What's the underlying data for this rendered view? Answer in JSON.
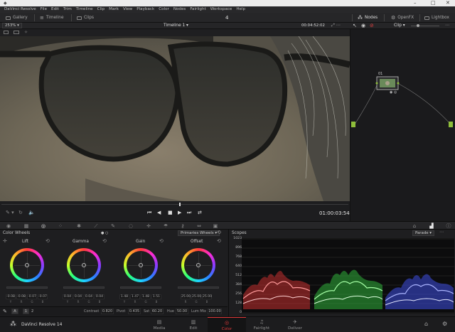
{
  "window": {
    "title": "DaVinci Resolve 14"
  },
  "menu": [
    "DaVinci Resolve",
    "File",
    "Edit",
    "Trim",
    "Timeline",
    "Clip",
    "Mark",
    "View",
    "Playback",
    "Color",
    "Nodes",
    "Fairlight",
    "Workspace",
    "Help"
  ],
  "topbar": {
    "gallery": "Gallery",
    "timeline": "Timeline",
    "clips": "Clips",
    "center_num": "4",
    "nodes": "Nodes",
    "openfx": "OpenFX",
    "lightbox": "Lightbox"
  },
  "viewer": {
    "zoom": "253%",
    "timeline_name": "Timeline 1",
    "timecode_top": "00:04:52:02",
    "timecode_bottom": "01:00:03:54"
  },
  "nodes": {
    "mode": "Clip",
    "node_label": "01"
  },
  "color_wheels": {
    "title": "Color Wheels",
    "mode": "Primaries Wheels",
    "wheels": [
      {
        "name": "Lift",
        "values": [
          "-0.08",
          "-0.08",
          "-0.07",
          "-0.07"
        ]
      },
      {
        "name": "Gamma",
        "values": [
          "0.04",
          "0.04",
          "0.04",
          "0.04"
        ]
      },
      {
        "name": "Gain",
        "values": [
          "1.48",
          "1.47",
          "1.48",
          "1.51"
        ]
      },
      {
        "name": "Offset",
        "values": [
          "25.00",
          "25.00",
          "25.00"
        ]
      }
    ],
    "channels4": [
      "Y",
      "R",
      "G",
      "B"
    ],
    "channels3": [
      "R",
      "G",
      "B"
    ]
  },
  "params": {
    "page_a": "A",
    "page_1": "1",
    "page_2": "2",
    "contrast_label": "Contrast",
    "contrast": "0.820",
    "pivot_label": "Pivot",
    "pivot": "0.435",
    "sat_label": "Sat",
    "sat": "60.20",
    "hue_label": "Hue",
    "hue": "50.00",
    "lummix_label": "Lum Mix",
    "lummix": "100.00"
  },
  "scopes": {
    "title": "Scopes",
    "mode": "Parade",
    "scale": [
      "1023",
      "896",
      "768",
      "640",
      "512",
      "384",
      "256",
      "128",
      "0"
    ]
  },
  "pages": [
    "Media",
    "Edit",
    "Color",
    "Fairlight",
    "Deliver"
  ],
  "active_page": "Color",
  "colors": {
    "accent": "#e03a3a",
    "panel": "#1e1e20",
    "viewer_bg": "#6a6659"
  }
}
